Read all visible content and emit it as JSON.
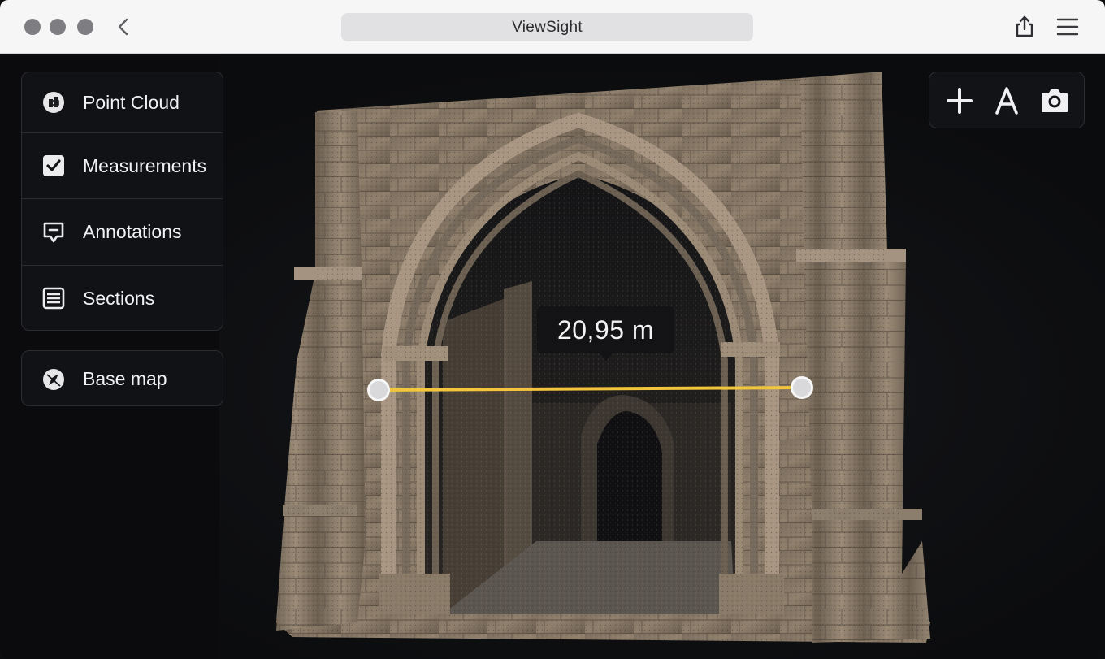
{
  "window": {
    "address": "ViewSight"
  },
  "sidebar": {
    "layers": [
      {
        "label": "Point Cloud",
        "icon": "point-cloud-icon"
      },
      {
        "label": "Measurements",
        "icon": "checkbox-checked-icon"
      },
      {
        "label": "Annotations",
        "icon": "annotation-icon"
      },
      {
        "label": "Sections",
        "icon": "sections-icon"
      }
    ],
    "base_map": {
      "label": "Base map",
      "icon": "compass-icon"
    }
  },
  "toolbar": {
    "tools": [
      {
        "icon": "plus-icon"
      },
      {
        "icon": "text-annotation-icon"
      },
      {
        "icon": "camera-icon"
      }
    ]
  },
  "measurement": {
    "value": "20,95 m",
    "line_color": "#f2c53d"
  },
  "colors": {
    "background": "#111214",
    "titlebar": "#f6f6f7",
    "panel_border": "#2c2d31",
    "stone": "#8a7a66"
  }
}
